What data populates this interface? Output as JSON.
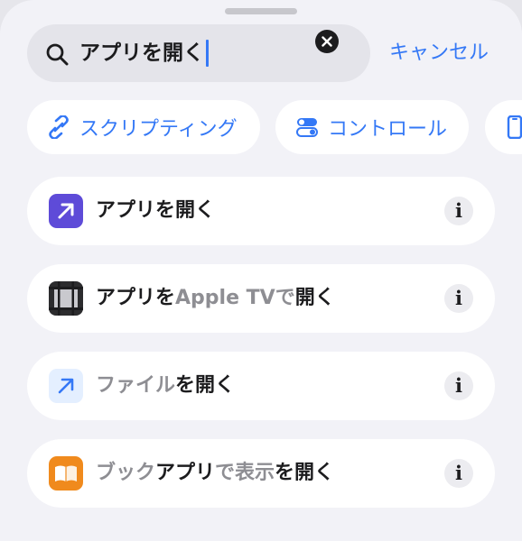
{
  "search": {
    "value": "アプリを開く"
  },
  "cancel_label": "キャンセル",
  "categories": [
    {
      "label": "スクリプティング",
      "icon": "link-icon"
    },
    {
      "label": "コントロール",
      "icon": "toggles-icon"
    },
    {
      "label": "",
      "icon": "iphone-icon"
    }
  ],
  "results": [
    {
      "segments": [
        "アプリを開く"
      ],
      "icon": "open-app-arrow-icon"
    },
    {
      "segments": [
        "アプリを",
        "Apple TV",
        "で",
        "開く"
      ],
      "icon": "apple-tv-icon"
    },
    {
      "segments": [
        "ファイル",
        "を開く"
      ],
      "icon": "open-file-arrow-icon"
    },
    {
      "segments": [
        "ブック",
        "アプリ",
        "で表示",
        "を開く"
      ],
      "icon": "books-icon"
    }
  ],
  "info_label": "i",
  "colors": {
    "accent": "#3478f6",
    "shortcut_purple": "#5e4bd8",
    "books_orange": "#f08a1d"
  }
}
